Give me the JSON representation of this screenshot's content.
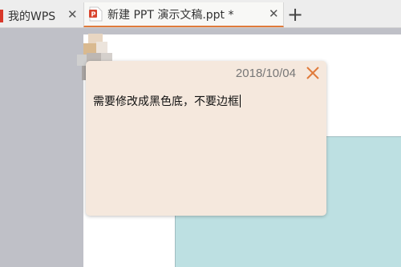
{
  "tabs": [
    {
      "label": "我的WPS",
      "active": false
    },
    {
      "label": "新建 PPT 演示文稿.ppt *",
      "active": true
    }
  ],
  "tab_close_glyph": "✕",
  "add_tab_glyph": "+",
  "comment": {
    "date": "2018/10/04",
    "text": "需要修改成黑色底，不要边框"
  },
  "colors": {
    "accent": "#e07b3c",
    "comment_bg": "#f5e8dd",
    "shape_fill": "#bde0e2",
    "workspace_bg": "#bfc0c7"
  },
  "icons": [
    "wps-logo-icon",
    "ppt-file-icon",
    "close-icon",
    "plus-icon",
    "avatar"
  ]
}
